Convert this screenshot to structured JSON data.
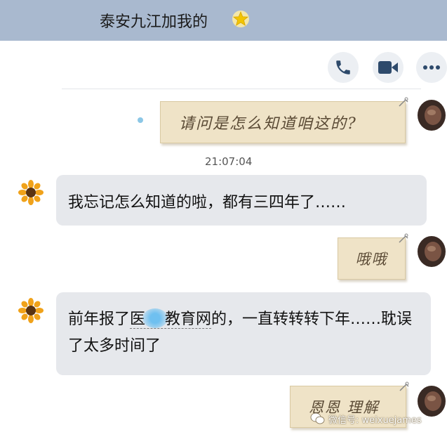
{
  "header": {
    "title": "泰安九江加我的",
    "star_icon": "star-icon"
  },
  "actions": [
    {
      "name": "phone-button",
      "icon": "phone-icon"
    },
    {
      "name": "video-button",
      "icon": "video-camera-icon"
    },
    {
      "name": "more-button",
      "icon": "more-dots-icon"
    }
  ],
  "messages": {
    "m1": {
      "side": "right",
      "text": "请问是怎么知道咱这的?"
    },
    "time1": "21:07:04",
    "m2": {
      "side": "left",
      "text": "我忘记怎么知道的啦，都有三四年了……"
    },
    "m3": {
      "side": "right",
      "text": "哦哦"
    },
    "m4": {
      "side": "left",
      "prefix": "前年报了",
      "underlined_a": "医",
      "underlined_b": "教育网",
      "suffix": "的，一直转转转下年……耽误了太多时间了"
    },
    "m5": {
      "side": "right",
      "text": "恩恩 理解"
    }
  },
  "watermark": {
    "text": "微信号: weixuejames"
  },
  "colors": {
    "header_bg": "#a9b9cf",
    "bubble_bg": "#e6e8ec",
    "note_bg": "#efe3c7"
  }
}
